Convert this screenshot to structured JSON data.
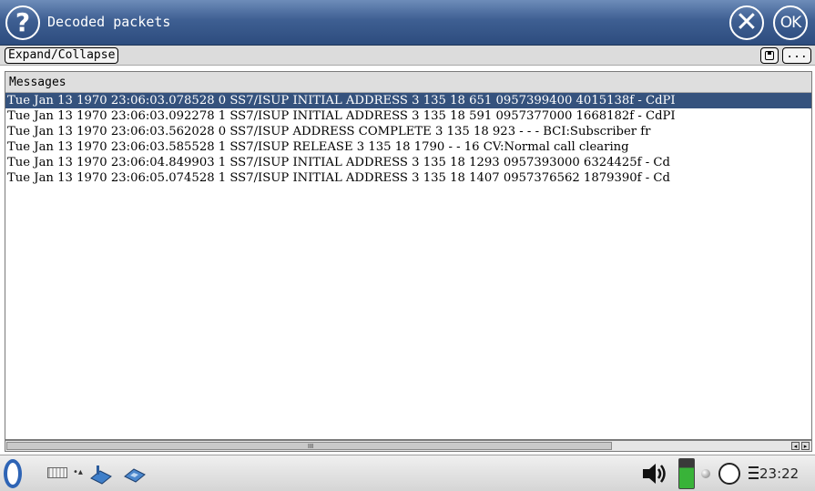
{
  "window": {
    "title": "Decoded packets",
    "help_glyph": "?",
    "close_glyph": "✕",
    "ok_label": "OK"
  },
  "toolbar": {
    "expand_label": "Expand/Collapse",
    "more_label": "..."
  },
  "messages": {
    "header": "Messages",
    "rows": [
      {
        "text": "Tue Jan 13 1970 23:06:03.078528 0 SS7/ISUP INITIAL ADDRESS 3 135 18 651 0957399400 4015138f - CdPI",
        "selected": true
      },
      {
        "text": "Tue Jan 13 1970 23:06:03.092278 1 SS7/ISUP INITIAL ADDRESS 3 135 18 591 0957377000 1668182f - CdPI",
        "selected": false
      },
      {
        "text": "Tue Jan 13 1970 23:06:03.562028 0 SS7/ISUP ADDRESS COMPLETE 3 135 18 923 - - - BCI:Subscriber fr",
        "selected": false
      },
      {
        "text": "Tue Jan 13 1970 23:06:03.585528 1 SS7/ISUP RELEASE 3 135 18 1790 - - 16 CV:Normal call clearing",
        "selected": false
      },
      {
        "text": "Tue Jan 13 1970 23:06:04.849903 1 SS7/ISUP INITIAL ADDRESS 3 135 18 1293 0957393000 6324425f - Cd",
        "selected": false
      },
      {
        "text": "Tue Jan 13 1970 23:06:05.074528 1 SS7/ISUP INITIAL ADDRESS 3 135 18 1407 0957376562 1879390f - Cd",
        "selected": false
      }
    ]
  },
  "scrollbar": {
    "grip": "III",
    "left_arrow": "◂",
    "right_arrow": "▸"
  },
  "taskbar": {
    "clock": "23:22",
    "dot_arrow": "•▴",
    "icons": [
      "menu-icon",
      "keyboard-icon",
      "app-icon",
      "app-icon",
      "speaker-icon",
      "battery-icon",
      "led-icon",
      "power-icon",
      "tray-menu-icon"
    ]
  },
  "colors": {
    "titlebar": "#3e5f92",
    "selection": "#35527d",
    "battery": "#39b339"
  }
}
